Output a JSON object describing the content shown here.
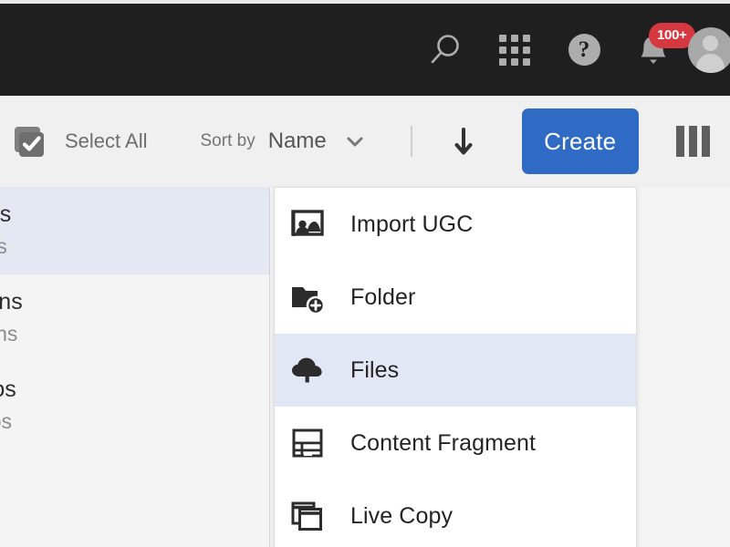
{
  "header": {
    "icons": [
      {
        "name": "search-icon",
        "label": "Search"
      },
      {
        "name": "app-grid-icon",
        "label": "Solutions"
      },
      {
        "name": "help-icon",
        "label": "Help",
        "glyph": "?"
      },
      {
        "name": "notifications-bell-icon",
        "label": "Notifications"
      },
      {
        "name": "user-avatar",
        "label": "User"
      }
    ],
    "notification_badge": "100+",
    "help_glyph": "?",
    "background_color": "#1f1f1f",
    "badge_color": "#d7373f"
  },
  "toolbar": {
    "select_all_label": "Select All",
    "sort_by_label": "Sort by",
    "sort_value": "Name",
    "sort_direction": "descending",
    "create_label": "Create",
    "rail_toggle_label": "Column View",
    "create_button_color": "#2f6ac4",
    "background_color": "#f0f0f0"
  },
  "sidebar": {
    "items": [
      {
        "title": "deos",
        "subtitle": "deos",
        "selected": true
      },
      {
        "title": "ptions",
        "subtitle": "ptions",
        "selected": false
      },
      {
        "title": "udios",
        "subtitle": "udios",
        "selected": false
      }
    ],
    "selected_color": "#e4e8f2",
    "background_color": "#f4f4f4"
  },
  "create_menu": {
    "highlighted_color": "#e1e7f5",
    "items": [
      {
        "label": "Import UGC",
        "icon": "import-ugc-icon",
        "highlighted": false
      },
      {
        "label": "Folder",
        "icon": "new-folder-icon",
        "highlighted": false
      },
      {
        "label": "Files",
        "icon": "cloud-upload-icon",
        "highlighted": true
      },
      {
        "label": "Content Fragment",
        "icon": "content-fragment-icon",
        "highlighted": false
      },
      {
        "label": "Live Copy",
        "icon": "live-copy-icon",
        "highlighted": false
      }
    ]
  }
}
